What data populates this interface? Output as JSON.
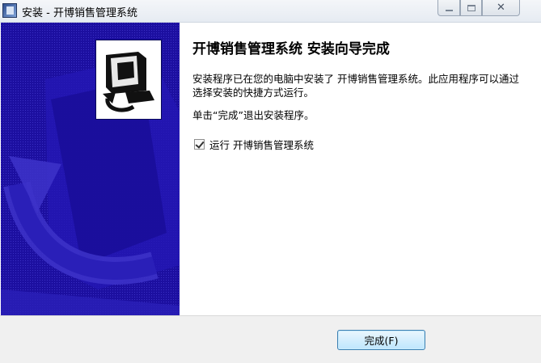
{
  "window": {
    "title": "安装 - 开博销售管理系统",
    "ghost_text": "",
    "controls": {
      "minimize": "",
      "maximize": "",
      "close": "✕"
    }
  },
  "wizard": {
    "heading": "开博销售管理系统 安装向导完成",
    "paragraph1": "安装程序已在您的电脑中安装了 开博销售管理系统。此应用程序可以通过选择安装的快捷方式运行。",
    "paragraph2": "单击“完成”退出安装程序。",
    "run_checkbox": {
      "label": "运行 开博销售管理系统",
      "checked": true
    }
  },
  "footer": {
    "finish_button": "完成(F)"
  },
  "colors": {
    "banner": "#1c0fa0",
    "button_border": "#3c7fb1"
  }
}
